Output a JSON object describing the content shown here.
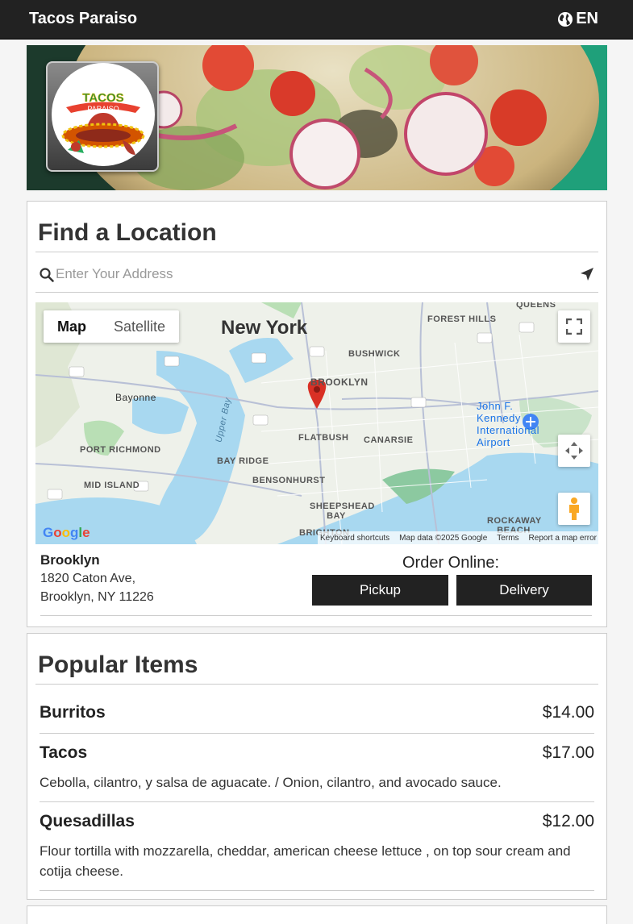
{
  "header": {
    "brand": "Tacos Paraiso",
    "language": "EN"
  },
  "logo": {
    "top_text": "TACOS",
    "banner_text": "PARAISO"
  },
  "find_location": {
    "title": "Find a Location",
    "search_placeholder": "Enter Your Address",
    "map": {
      "map_button": "Map",
      "satellite_button": "Satellite",
      "city": "New York",
      "labels": [
        "QUEENS",
        "FOREST HILLS",
        "BUSHWICK",
        "BROOKLYN",
        "Bayonne",
        "PORT RICHMOND",
        "BAY RIDGE",
        "FLATBUSH",
        "CANARSIE",
        "BENSONHURST",
        "MID ISLAND",
        "SHEEPSHEAD BAY",
        "ROCKAWAY BEACH",
        "BRIGHTON",
        "John F. Kennedy International Airport",
        "Upper Bay"
      ],
      "attribution": [
        "Keyboard shortcuts",
        "Map data ©2025 Google",
        "Terms",
        "Report a map error"
      ],
      "google": "Google"
    },
    "location": {
      "name": "Brooklyn",
      "address_line1": "1820 Caton Ave,",
      "address_line2": "Brooklyn, NY 11226"
    },
    "order_online_label": "Order Online:",
    "pickup_label": "Pickup",
    "delivery_label": "Delivery"
  },
  "popular": {
    "title": "Popular Items",
    "items": [
      {
        "name": "Burritos",
        "price": "$14.00",
        "description": ""
      },
      {
        "name": "Tacos",
        "price": "$17.00",
        "description": "Cebolla, cilantro, y salsa de aguacate. / Onion, cilantro, and avocado sauce."
      },
      {
        "name": "Quesadillas",
        "price": "$12.00",
        "description": "Flour tortilla with mozzarella, cheddar, american cheese lettuce , on top sour cream and cotija cheese."
      }
    ]
  },
  "colors": {
    "header_bg": "#222222",
    "button_bg": "#222222",
    "map_pin": "#d93025"
  }
}
